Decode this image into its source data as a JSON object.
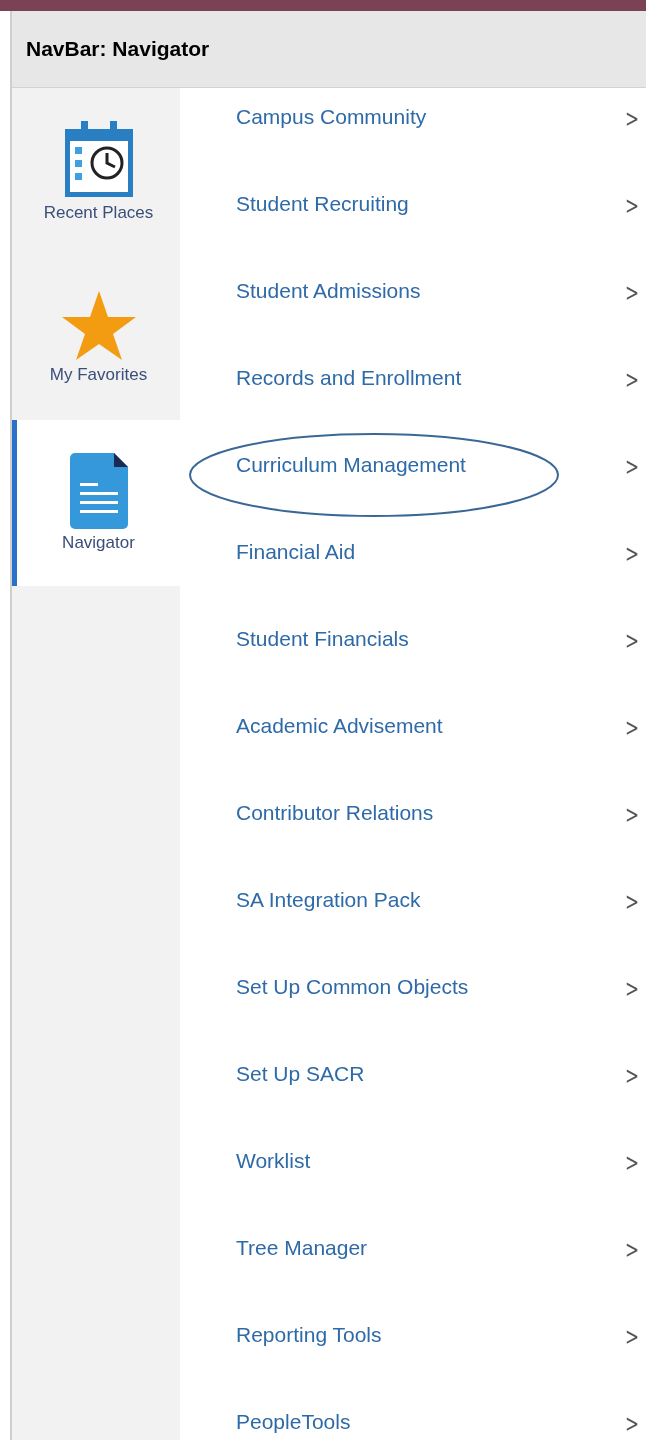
{
  "header": {
    "title": "NavBar: Navigator"
  },
  "sidebar": {
    "items": [
      {
        "kind": "calendar",
        "label": "Recent Places",
        "selected": false
      },
      {
        "kind": "star",
        "label": "My Favorites",
        "selected": false
      },
      {
        "kind": "document",
        "label": "Navigator",
        "selected": true
      }
    ]
  },
  "menu": {
    "items": [
      {
        "label": "Campus Community",
        "circled": false,
        "chevron": ">"
      },
      {
        "label": "Student Recruiting",
        "circled": false,
        "chevron": ">"
      },
      {
        "label": "Student Admissions",
        "circled": false,
        "chevron": ">"
      },
      {
        "label": "Records and Enrollment",
        "circled": false,
        "chevron": ">"
      },
      {
        "label": "Curriculum Management",
        "circled": true,
        "chevron": ">"
      },
      {
        "label": "Financial Aid",
        "circled": false,
        "chevron": ">"
      },
      {
        "label": "Student Financials",
        "circled": false,
        "chevron": ">"
      },
      {
        "label": "Academic Advisement",
        "circled": false,
        "chevron": ">"
      },
      {
        "label": "Contributor Relations",
        "circled": false,
        "chevron": ">"
      },
      {
        "label": "SA Integration Pack",
        "circled": false,
        "chevron": ">"
      },
      {
        "label": "Set Up Common Objects",
        "circled": false,
        "chevron": ">"
      },
      {
        "label": "Set Up SACR",
        "circled": false,
        "chevron": ">"
      },
      {
        "label": "Worklist",
        "circled": false,
        "chevron": ">"
      },
      {
        "label": "Tree Manager",
        "circled": false,
        "chevron": ">"
      },
      {
        "label": "Reporting Tools",
        "circled": false,
        "chevron": ">"
      },
      {
        "label": "PeopleTools",
        "circled": false,
        "chevron": ">"
      }
    ]
  }
}
